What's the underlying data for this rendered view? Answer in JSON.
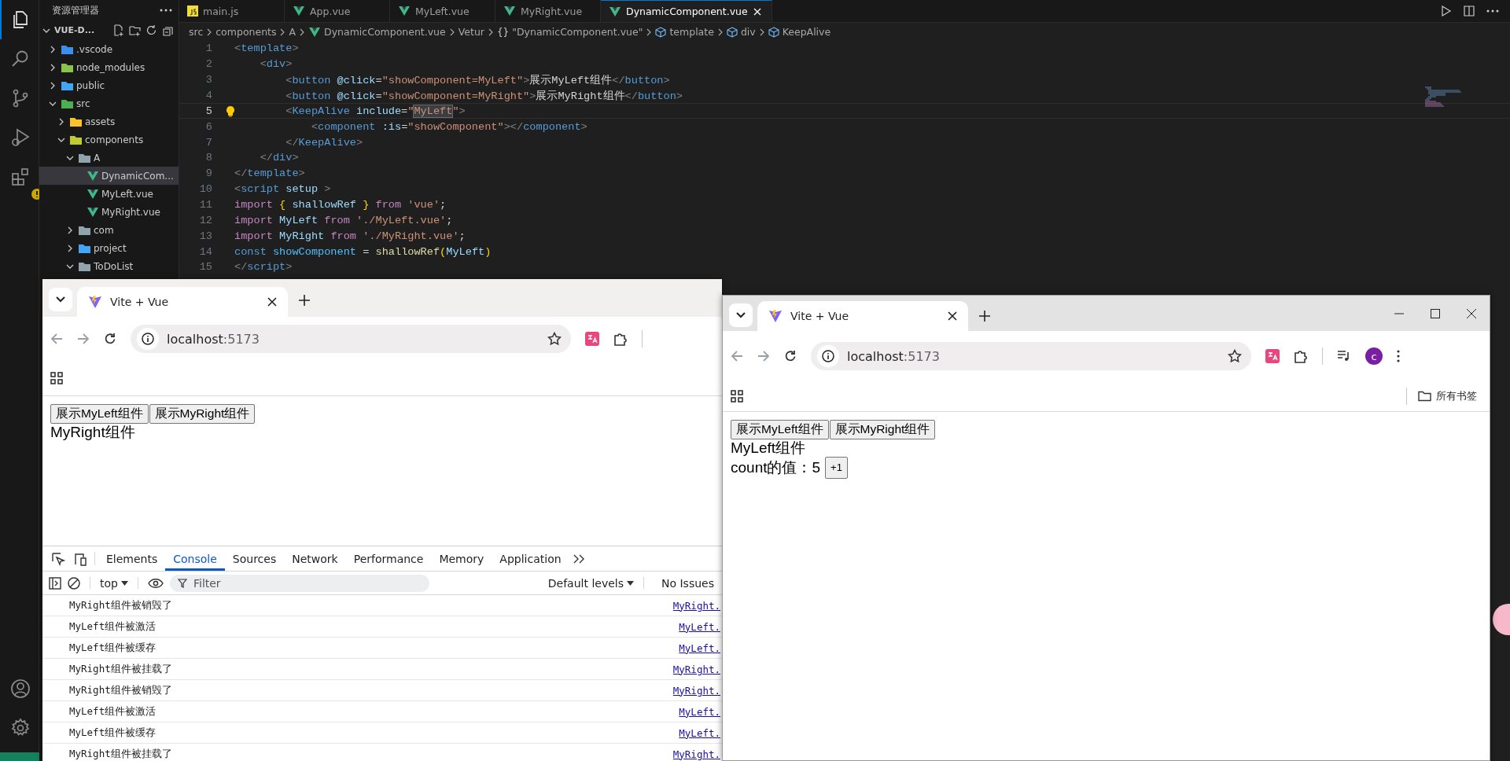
{
  "activity_bar": {
    "items": [
      {
        "kind": "explorer",
        "selected": true
      },
      {
        "kind": "search",
        "selected": false
      },
      {
        "kind": "source-control",
        "selected": false
      },
      {
        "kind": "run-debug",
        "selected": false
      },
      {
        "kind": "extensions",
        "selected": false
      }
    ],
    "bottom_items": [
      {
        "kind": "account"
      },
      {
        "kind": "settings"
      }
    ]
  },
  "explorer": {
    "title": "资源管理器",
    "project": "VUE-D...",
    "project_expanded": true,
    "tree": [
      {
        "label": ".vscode",
        "kind": "folder",
        "color": "#3c8ee8",
        "expanded": false,
        "selected": false
      },
      {
        "label": "node_modules",
        "kind": "folder",
        "color": "#8bc34a",
        "expanded": false,
        "selected": false
      },
      {
        "label": "public",
        "kind": "folder",
        "color": "#42a5f5",
        "expanded": false,
        "selected": false
      },
      {
        "label": "src",
        "kind": "folder",
        "color": "#4caf50",
        "expanded": true,
        "selected": false,
        "children": [
          {
            "label": "assets",
            "kind": "folder",
            "color": "#f9c42a",
            "expanded": false,
            "selected": false
          },
          {
            "label": "components",
            "kind": "folder",
            "color": "#c0ca33",
            "expanded": true,
            "selected": false,
            "children": [
              {
                "label": "A",
                "kind": "folder",
                "color": "#90a4ae",
                "expanded": true,
                "selected": false,
                "children": [
                  {
                    "label": "DynamicCom...",
                    "kind": "vue",
                    "selected": true
                  },
                  {
                    "label": "MyLeft.vue",
                    "kind": "vue",
                    "selected": false
                  },
                  {
                    "label": "MyRight.vue",
                    "kind": "vue",
                    "selected": false
                  }
                ]
              },
              {
                "label": "com",
                "kind": "folder",
                "color": "#90a4ae",
                "expanded": false,
                "selected": false
              },
              {
                "label": "project",
                "kind": "folder",
                "color": "#42a5f5",
                "expanded": false,
                "selected": false
              },
              {
                "label": "ToDoList",
                "kind": "folder",
                "color": "#90a4ae",
                "expanded": true,
                "selected": false
              }
            ]
          }
        ]
      }
    ]
  },
  "editor": {
    "tabs": [
      {
        "label": "main.js",
        "kind": "js",
        "selected": false
      },
      {
        "label": "App.vue",
        "kind": "vue",
        "selected": false
      },
      {
        "label": "MyLeft.vue",
        "kind": "vue",
        "selected": false
      },
      {
        "label": "MyRight.vue",
        "kind": "vue",
        "selected": false
      },
      {
        "label": "DynamicComponent.vue",
        "kind": "vue",
        "selected": true
      }
    ],
    "breadcrumb": [
      {
        "label": "src",
        "kind": "plain"
      },
      {
        "label": "components",
        "kind": "plain"
      },
      {
        "label": "A",
        "kind": "plain"
      },
      {
        "label": "DynamicComponent.vue",
        "kind": "vue"
      },
      {
        "label": "Vetur",
        "kind": "plain"
      },
      {
        "label": "\"DynamicComponent.vue\"",
        "kind": "symbol",
        "symbol": "{}"
      },
      {
        "label": "template",
        "kind": "element"
      },
      {
        "label": "div",
        "kind": "element"
      },
      {
        "label": "KeepAlive",
        "kind": "element"
      }
    ],
    "lines": [
      {
        "number": "1",
        "active": false,
        "tokens": [
          {
            "kind": "bracket",
            "text": "<"
          },
          {
            "kind": "tag",
            "text": "template"
          },
          {
            "kind": "bracket",
            "text": ">"
          }
        ],
        "children": [
          {
            "number": "2",
            "active": false,
            "tokens": [
              {
                "kind": "bracket",
                "text": "<"
              },
              {
                "kind": "tag",
                "text": "div"
              },
              {
                "kind": "bracket",
                "text": ">"
              }
            ],
            "children": [
              {
                "number": "3",
                "active": false,
                "tokens": [
                  {
                    "kind": "bracket",
                    "text": "<"
                  },
                  {
                    "kind": "tag",
                    "text": "button"
                  },
                  {
                    "kind": "attr",
                    "text": " @click"
                  },
                  {
                    "kind": "text",
                    "text": "="
                  },
                  {
                    "kind": "string",
                    "text": "\"showComponent=MyLeft\""
                  },
                  {
                    "kind": "bracket",
                    "text": ">"
                  },
                  {
                    "kind": "text",
                    "text": "展示MyLeft组件"
                  },
                  {
                    "kind": "bracket",
                    "text": "</"
                  },
                  {
                    "kind": "tag",
                    "text": "button"
                  },
                  {
                    "kind": "bracket",
                    "text": ">"
                  }
                ]
              },
              {
                "number": "4",
                "active": false,
                "tokens": [
                  {
                    "kind": "bracket",
                    "text": "<"
                  },
                  {
                    "kind": "tag",
                    "text": "button"
                  },
                  {
                    "kind": "attr",
                    "text": " @click"
                  },
                  {
                    "kind": "text",
                    "text": "="
                  },
                  {
                    "kind": "string",
                    "text": "\"showComponent=MyRight\""
                  },
                  {
                    "kind": "bracket",
                    "text": ">"
                  },
                  {
                    "kind": "text",
                    "text": "展示MyRight组件"
                  },
                  {
                    "kind": "bracket",
                    "text": "</"
                  },
                  {
                    "kind": "tag",
                    "text": "button"
                  },
                  {
                    "kind": "bracket",
                    "text": ">"
                  }
                ]
              },
              {
                "number": "5",
                "active": true,
                "tokens": [
                  {
                    "kind": "bracket",
                    "text": "<"
                  },
                  {
                    "kind": "tag",
                    "text": "KeepAlive"
                  },
                  {
                    "kind": "attr",
                    "text": " include"
                  },
                  {
                    "kind": "text",
                    "text": "="
                  },
                  {
                    "kind": "string",
                    "text": "\""
                  },
                  {
                    "kind": "string",
                    "text": "MyLeft",
                    "highlight": true
                  },
                  {
                    "kind": "string",
                    "text": "\""
                  },
                  {
                    "kind": "bracket",
                    "text": ">"
                  }
                ],
                "children": [
                  {
                    "number": "6",
                    "active": false,
                    "tokens": [
                      {
                        "kind": "bracket",
                        "text": "<"
                      },
                      {
                        "kind": "tag",
                        "text": "component"
                      },
                      {
                        "kind": "attr",
                        "text": " :is"
                      },
                      {
                        "kind": "text",
                        "text": "="
                      },
                      {
                        "kind": "string",
                        "text": "\"showComponent\""
                      },
                      {
                        "kind": "bracket",
                        "text": "></"
                      },
                      {
                        "kind": "tag",
                        "text": "component"
                      },
                      {
                        "kind": "bracket",
                        "text": ">"
                      }
                    ]
                  }
                ]
              },
              {
                "number": "7",
                "active": false,
                "tokens": [
                  {
                    "kind": "bracket",
                    "text": "</"
                  },
                  {
                    "kind": "tag",
                    "text": "KeepAlive"
                  },
                  {
                    "kind": "bracket",
                    "text": ">"
                  }
                ]
              }
            ]
          },
          {
            "number": "8",
            "active": false,
            "tokens": [
              {
                "kind": "bracket",
                "text": "</"
              },
              {
                "kind": "tag",
                "text": "div"
              },
              {
                "kind": "bracket",
                "text": ">"
              }
            ]
          }
        ]
      },
      {
        "number": "9",
        "active": false,
        "tokens": [
          {
            "kind": "bracket",
            "text": "</"
          },
          {
            "kind": "tag",
            "text": "template"
          },
          {
            "kind": "bracket",
            "text": ">"
          }
        ]
      },
      {
        "number": "10",
        "active": false,
        "tokens": [
          {
            "kind": "bracket",
            "text": "<"
          },
          {
            "kind": "tag",
            "text": "script"
          },
          {
            "kind": "attr",
            "text": " setup"
          },
          {
            "kind": "bracket",
            "text": " >"
          }
        ]
      },
      {
        "number": "11",
        "active": false,
        "tokens": [
          {
            "kind": "keyword",
            "text": "import"
          },
          {
            "kind": "brace",
            "text": " {"
          },
          {
            "kind": "var",
            "text": " shallowRef"
          },
          {
            "kind": "brace",
            "text": " }"
          },
          {
            "kind": "keyword",
            "text": " from"
          },
          {
            "kind": "string",
            "text": " 'vue'"
          },
          {
            "kind": "text",
            "text": ";"
          }
        ]
      },
      {
        "number": "12",
        "active": false,
        "tokens": [
          {
            "kind": "keyword",
            "text": "import"
          },
          {
            "kind": "var",
            "text": " MyLeft"
          },
          {
            "kind": "keyword",
            "text": " from"
          },
          {
            "kind": "string",
            "text": " './MyLeft.vue'"
          },
          {
            "kind": "text",
            "text": ";"
          }
        ]
      },
      {
        "number": "13",
        "active": false,
        "tokens": [
          {
            "kind": "keyword",
            "text": "import"
          },
          {
            "kind": "var",
            "text": " MyRight"
          },
          {
            "kind": "keyword",
            "text": " from"
          },
          {
            "kind": "string",
            "text": " './MyRight.vue'"
          },
          {
            "kind": "text",
            "text": ";"
          }
        ]
      },
      {
        "number": "14",
        "active": false,
        "tokens": [
          {
            "kind": "storage",
            "text": "const"
          },
          {
            "kind": "const",
            "text": " showComponent"
          },
          {
            "kind": "text",
            "text": " = "
          },
          {
            "kind": "func",
            "text": "shallowRef"
          },
          {
            "kind": "brace",
            "text": "("
          },
          {
            "kind": "var",
            "text": "MyLeft"
          },
          {
            "kind": "brace",
            "text": ")"
          }
        ]
      },
      {
        "number": "15",
        "active": false,
        "tokens": [
          {
            "kind": "bracket",
            "text": "</"
          },
          {
            "kind": "tag",
            "text": "script"
          },
          {
            "kind": "bracket",
            "text": ">"
          }
        ]
      }
    ]
  },
  "browsers": [
    {
      "tab_title": "Vite + Vue",
      "url_host": "localhost",
      "url_port": ":5173",
      "window_controls": false,
      "page": {
        "buttons": [
          "展示MyLeft组件",
          "展示MyRight组件"
        ],
        "lines": [
          {
            "kind": "text",
            "text": "MyRight组件"
          }
        ]
      },
      "devtools": {
        "tabs": [
          {
            "label": "Elements",
            "selected": false
          },
          {
            "label": "Console",
            "selected": true
          },
          {
            "label": "Sources",
            "selected": false
          },
          {
            "label": "Network",
            "selected": false
          },
          {
            "label": "Performance",
            "selected": false
          },
          {
            "label": "Memory",
            "selected": false
          },
          {
            "label": "Application",
            "selected": false
          }
        ],
        "context": "top",
        "filter_placeholder": "Filter",
        "levels": "Default levels",
        "issues": "No Issues",
        "messages": [
          {
            "text": "MyRight组件被销毁了",
            "source": "MyRight."
          },
          {
            "text": "MyLeft组件被激活",
            "source": "MyLeft."
          },
          {
            "text": "MyLeft组件被缓存",
            "source": "MyLeft."
          },
          {
            "text": "MyRight组件被挂载了",
            "source": "MyRight."
          },
          {
            "text": "MyRight组件被销毁了",
            "source": "MyRight."
          },
          {
            "text": "MyLeft组件被激活",
            "source": "MyLeft."
          },
          {
            "text": "MyLeft组件被缓存",
            "source": "MyLeft."
          },
          {
            "text": "MyRight组件被挂载了",
            "source": "MyRight."
          }
        ]
      }
    },
    {
      "tab_title": "Vite + Vue",
      "url_host": "localhost",
      "url_port": ":5173",
      "window_controls": true,
      "profile_initial": "c",
      "bookmarks_label": "所有书签",
      "page": {
        "buttons": [
          "展示MyLeft组件",
          "展示MyRight组件"
        ],
        "lines": [
          {
            "kind": "text",
            "text": "MyLeft组件"
          },
          {
            "kind": "counter",
            "text": "count的值：5",
            "button": "+1"
          }
        ]
      }
    }
  ]
}
